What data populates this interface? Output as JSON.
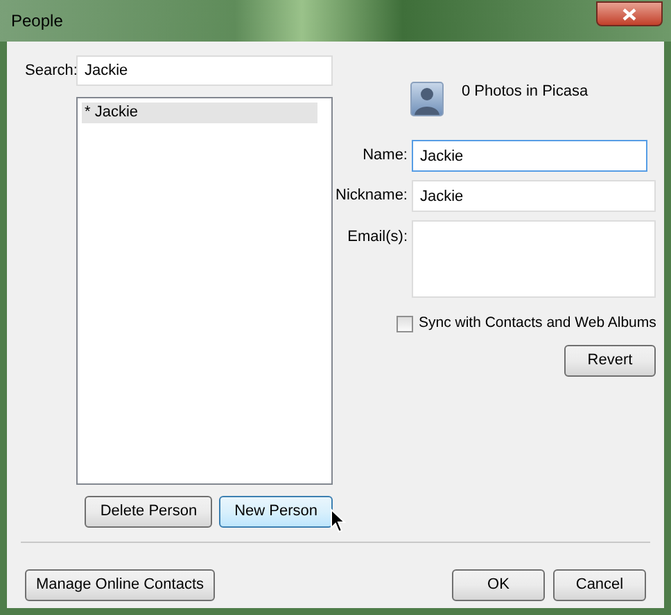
{
  "window": {
    "title": "People"
  },
  "search": {
    "label": "Search:",
    "value": "Jackie"
  },
  "people_list": [
    {
      "label": "* Jackie",
      "selected": true
    }
  ],
  "list_buttons": [
    {
      "label": "Delete Person",
      "hovered": false
    },
    {
      "label": "New Person",
      "hovered": true
    }
  ],
  "photos_count": "0 Photos in Picasa",
  "fields": [
    {
      "label": "Name:",
      "value": "Jackie",
      "kind": "line",
      "focused": true
    },
    {
      "label": "Nickname:",
      "value": "Jackie",
      "kind": "line",
      "focused": false
    },
    {
      "label": "Email(s):",
      "kind": "area",
      "focused": false
    }
  ],
  "sync": {
    "label": "Sync with Contacts and Web Albums",
    "checked": false
  },
  "revert_button": "Revert",
  "footer": {
    "manage_button": "Manage Online Contacts",
    "ok_button": "OK",
    "cancel_button": "Cancel"
  }
}
